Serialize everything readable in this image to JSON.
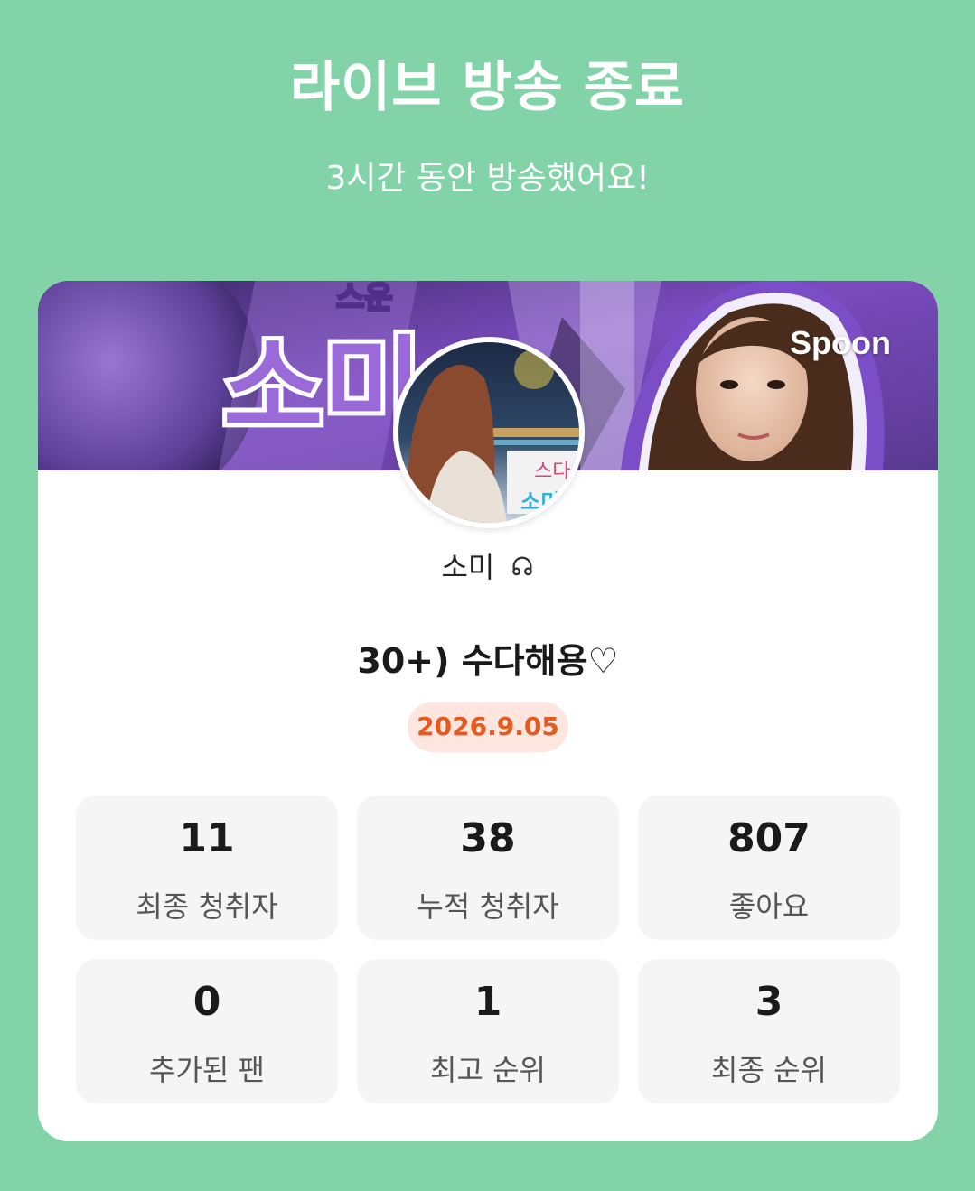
{
  "header": {
    "title": "라이브 방송 종료",
    "subtitle": "3시간 동안 방송했어요!"
  },
  "banner": {
    "brand": "Spoon",
    "banner_text": "소미"
  },
  "profile": {
    "nickname": "소미",
    "badge_icon": "headphones-icon"
  },
  "live": {
    "title": "30+) 수다해용♡",
    "date": "2026.9.05"
  },
  "stats": [
    {
      "value": "11",
      "label": "최종 청취자"
    },
    {
      "value": "38",
      "label": "누적 청취자"
    },
    {
      "value": "807",
      "label": "좋아요"
    },
    {
      "value": "0",
      "label": "추가된 팬"
    },
    {
      "value": "1",
      "label": "최고 순위"
    },
    {
      "value": "3",
      "label": "최종 순위"
    }
  ],
  "colors": {
    "background": "#82d4a8",
    "card": "#ffffff",
    "date_pill_bg": "#fde6df",
    "date_pill_text": "#e45a1f",
    "stat_tile": "#f5f5f5",
    "banner_accent": "#8b5cc9"
  }
}
